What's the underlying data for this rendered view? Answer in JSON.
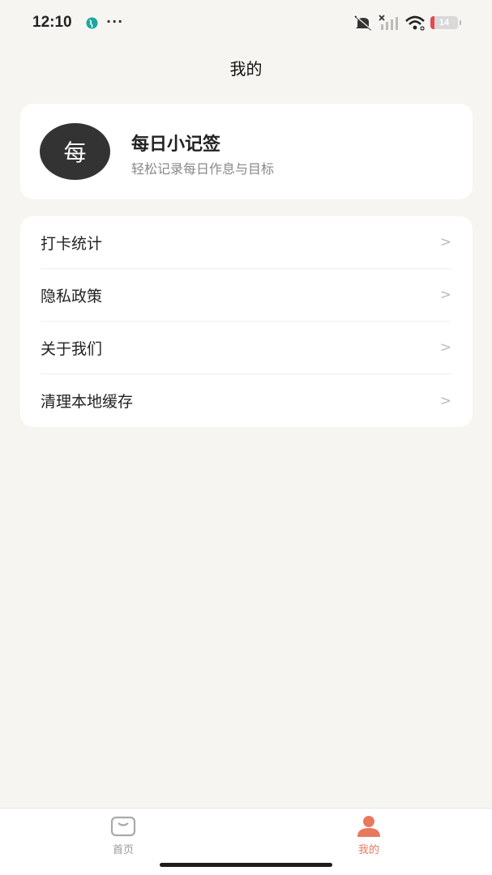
{
  "status_bar": {
    "time": "12:10",
    "dots": "···",
    "battery_level": "14",
    "battery_fraction": 0.14,
    "icons": [
      "globe-icon",
      "mute-icon",
      "signal-off-icon",
      "wifi-icon",
      "battery-icon"
    ]
  },
  "nav": {
    "title": "我的"
  },
  "profile": {
    "avatar_text": "每",
    "name": "每日小记签",
    "subtitle": "轻松记录每日作息与目标"
  },
  "menu": {
    "items": [
      {
        "label": "打卡统计",
        "arrow": ">"
      },
      {
        "label": "隐私政策",
        "arrow": ">"
      },
      {
        "label": "关于我们",
        "arrow": ">"
      },
      {
        "label": "清理本地缓存",
        "arrow": ">"
      }
    ]
  },
  "tabs": {
    "home": {
      "label": "首页",
      "icon": "home-bag-icon"
    },
    "mine": {
      "label": "我的",
      "icon": "user-icon",
      "active": true
    }
  },
  "colors": {
    "background": "#f6f5f2",
    "card": "#ffffff",
    "accent": "#e8795c",
    "avatar_bg": "#333333",
    "battery_low": "#e5484d"
  }
}
